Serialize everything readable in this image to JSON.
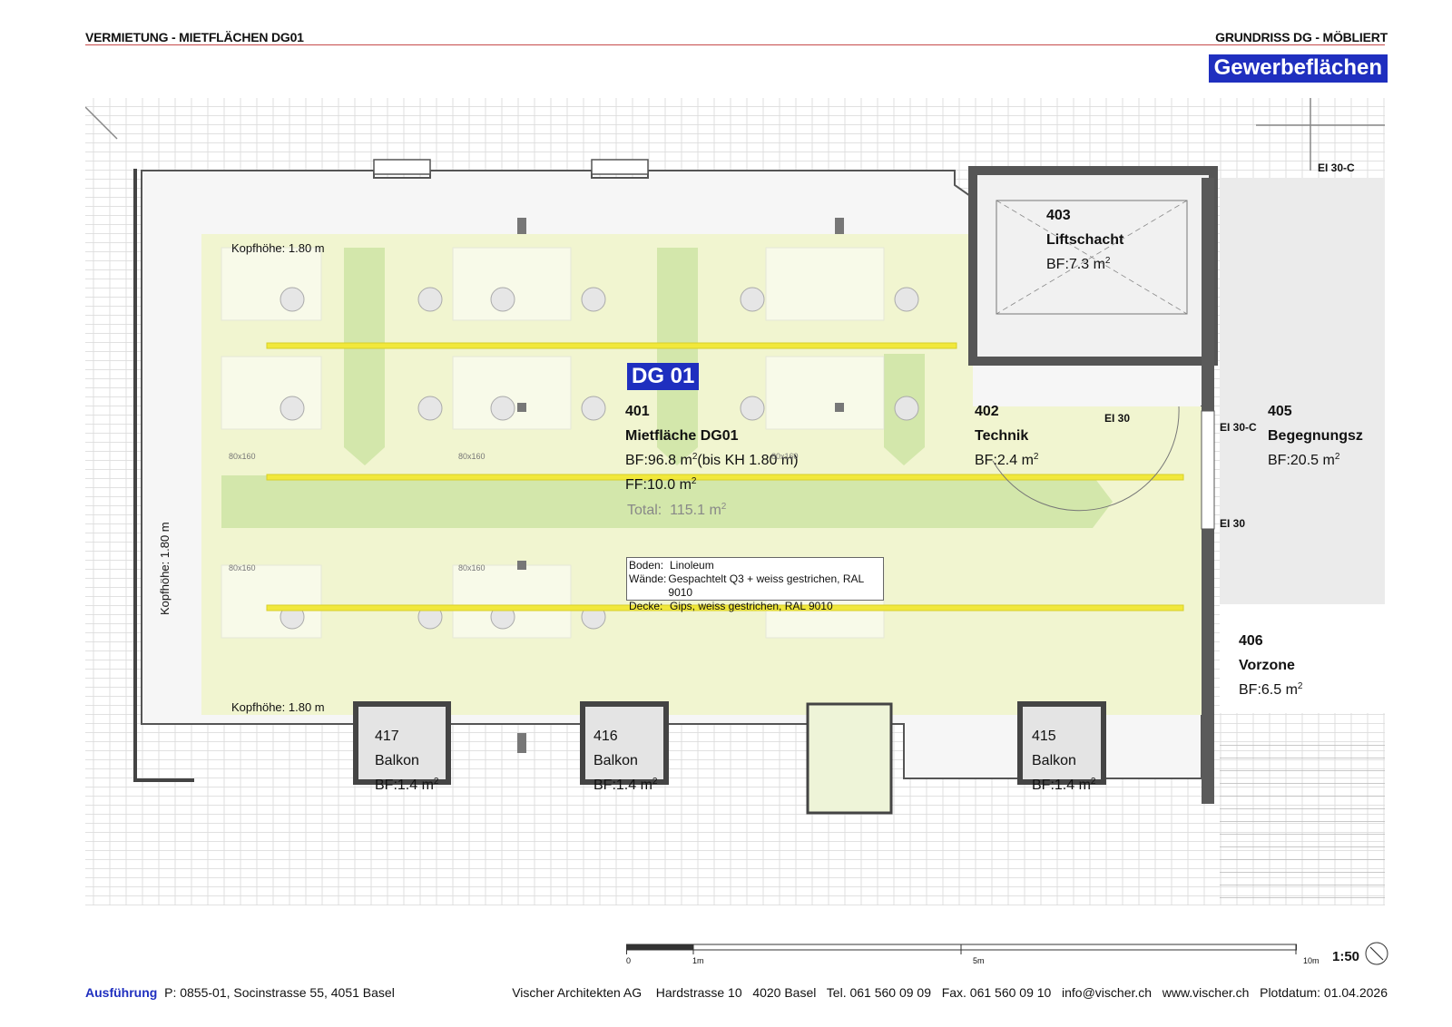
{
  "header": {
    "left_title": "VERMIETUNG - MIETFLÄCHEN DG01",
    "right_title": "GRUNDRISS  DG - MÖBLIERT",
    "category_badge": "Gewerbeflächen"
  },
  "plan": {
    "unit_tag": "DG 01",
    "rooms": [
      {
        "number": "401",
        "name": "Mietfläche DG01",
        "area": "BF:96.8 m",
        "area_note": "(bis KH 1.80 m)",
        "ff": "FF:10.0 m",
        "total_label": "Total:",
        "total_value": "115.1 m"
      },
      {
        "number": "402",
        "name": "Technik",
        "area": "BF:2.4 m"
      },
      {
        "number": "403",
        "name": "Liftschacht",
        "area": "BF:7.3 m"
      },
      {
        "number": "405",
        "name": "Begegnungsz",
        "area": "BF:20.5 m"
      },
      {
        "number": "406",
        "name": "Vorzone",
        "area": "BF:6.5 m"
      },
      {
        "number": "417",
        "name": "Balkon",
        "area": "BF:1.4 m"
      },
      {
        "number": "416",
        "name": "Balkon",
        "area": "BF:1.4 m"
      },
      {
        "number": "415",
        "name": "Balkon",
        "area": "BF:1.4 m"
      }
    ],
    "superscript": "2",
    "headroom_labels": {
      "top": "Kopfhöhe: 1.80 m",
      "bottom": "Kopfhöhe: 1.80 m",
      "left": "Kopfhöhe: 1.80 m"
    },
    "fire_ratings": {
      "ei30c_top": "EI 30-C",
      "ei30_door": "EI 30",
      "ei30c_mid": "EI 30-C",
      "ei30_lower": "EI 30"
    },
    "desk_labels": [
      "80x160",
      "80x160",
      "80x160",
      "80x160",
      "80x160"
    ],
    "finishes": [
      {
        "key": "Boden:",
        "value": "Linoleum"
      },
      {
        "key": "Wände:",
        "value": "Gespachtelt Q3 + weiss gestrichen, RAL 9010"
      },
      {
        "key": "Decke:",
        "value": "Gips, weiss gestrichen, RAL 9010"
      }
    ]
  },
  "scale_bar": {
    "ticks": [
      "0",
      "1m",
      "5m",
      "10m"
    ],
    "ratio": "1:50"
  },
  "footer": {
    "label": "Ausführung",
    "project": "P: 0855-01, Socinstrasse 55, 4051 Basel",
    "firm": "Vischer Architekten AG",
    "street": "Hardstrasse 10",
    "city": "4020 Basel",
    "tel": "Tel. 061 560 09 09",
    "fax": "Fax. 061 560 09 10",
    "email": "info@vischer.ch",
    "web": "www.vischer.ch",
    "plot_date": "Plotdatum: 01.04.2026"
  },
  "colors": {
    "accent_blue": "#1f2fbf",
    "rental_area": "#f1f5d0",
    "circulation_green": "#cfe6a6",
    "light_line": "#f1e83b",
    "header_rule": "#c64a4a"
  }
}
